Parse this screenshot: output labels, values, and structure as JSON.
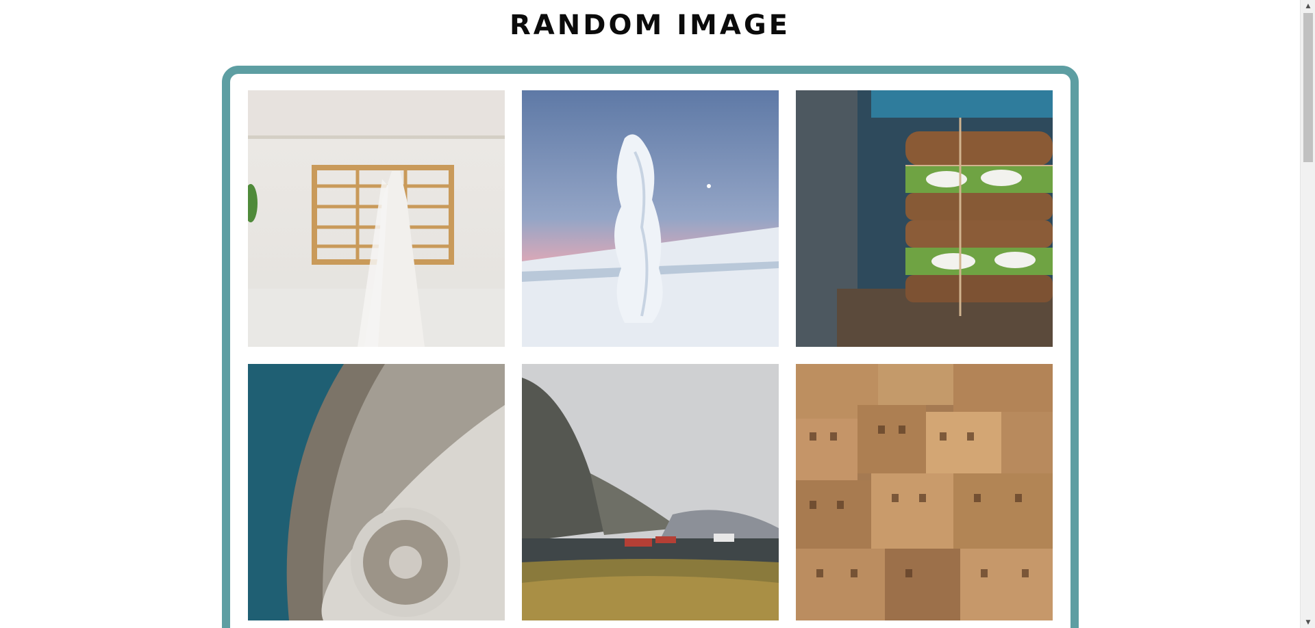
{
  "page": {
    "title": "RANDOM IMAGE"
  },
  "colors": {
    "frame_border": "#5d9ea2",
    "background": "#ffffff",
    "title_text": "#0b0b0b"
  },
  "gallery": {
    "images": [
      {
        "name": "wedding-dress-window-image",
        "subject": "wedding dress hanging on wooden window frame"
      },
      {
        "name": "snowy-tree-image",
        "subject": "snow covered tree on winter hill at dusk"
      },
      {
        "name": "sandwich-image",
        "subject": "stacked sandwiches tied with twine"
      },
      {
        "name": "breakwater-aerial-image",
        "subject": "aerial view of concrete breakwater and sea"
      },
      {
        "name": "fjord-mountain-image",
        "subject": "mountain fjord with red cabins"
      },
      {
        "name": "city-buildings-image",
        "subject": "dense hillside city buildings"
      }
    ]
  },
  "scrollbar": {
    "up_icon": "chevron-up-icon",
    "down_icon": "chevron-down-icon"
  }
}
